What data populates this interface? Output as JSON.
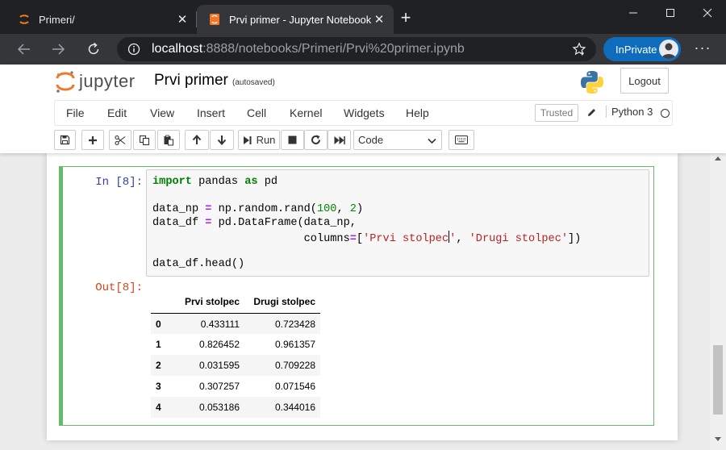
{
  "browser": {
    "tabs": [
      {
        "title": "Primeri/",
        "icon": "jupyter-favicon",
        "active": false
      },
      {
        "title": "Prvi primer - Jupyter Notebook",
        "icon": "jupyter-notebook-favicon",
        "active": true
      }
    ],
    "close_glyph": "✕",
    "new_tab_glyph": "+",
    "url_host": "localhost",
    "url_rest": ":8888/notebooks/Primeri/Prvi%20primer.ipynb",
    "inprivate_label": "InPrivate",
    "more_glyph": "···"
  },
  "jupyter": {
    "logo_text": "jupyter",
    "notebook_title": "Prvi primer",
    "autosave_status": "(autosaved)",
    "logout_label": "Logout",
    "menu": [
      "File",
      "Edit",
      "View",
      "Insert",
      "Cell",
      "Kernel",
      "Widgets",
      "Help"
    ],
    "trusted_label": "Trusted",
    "kernel_name": "Python 3",
    "toolbar": {
      "run_label": "Run",
      "cell_type": "Code"
    }
  },
  "cell": {
    "in_prompt": "In [8]:",
    "out_prompt": "Out[8]:",
    "code_lines": [
      "import pandas as pd",
      "",
      "data_np = np.random.rand(100, 2)",
      "data_df = pd.DataFrame(data_np,",
      "                       columns=['Prvi stolpec', 'Drugi stolpec'])",
      "",
      "data_df.head()"
    ]
  },
  "dataframe": {
    "columns": [
      "Prvi stolpec",
      "Drugi stolpec"
    ],
    "rows": [
      {
        "index": "0",
        "c1": "0.433111",
        "c2": "0.723428"
      },
      {
        "index": "1",
        "c1": "0.826452",
        "c2": "0.961357"
      },
      {
        "index": "2",
        "c1": "0.031595",
        "c2": "0.709228"
      },
      {
        "index": "3",
        "c1": "0.307257",
        "c2": "0.071546"
      },
      {
        "index": "4",
        "c1": "0.053186",
        "c2": "0.344016"
      }
    ]
  },
  "colors": {
    "chrome_dark": "#202124",
    "chrome_toolbar": "#35363a",
    "inprivate_blue": "#0f6cbd",
    "cell_border_green": "#66bb6a",
    "in_prompt_blue": "#303f9f",
    "out_prompt_red": "#d84315",
    "jupyter_orange": "#f37726"
  }
}
